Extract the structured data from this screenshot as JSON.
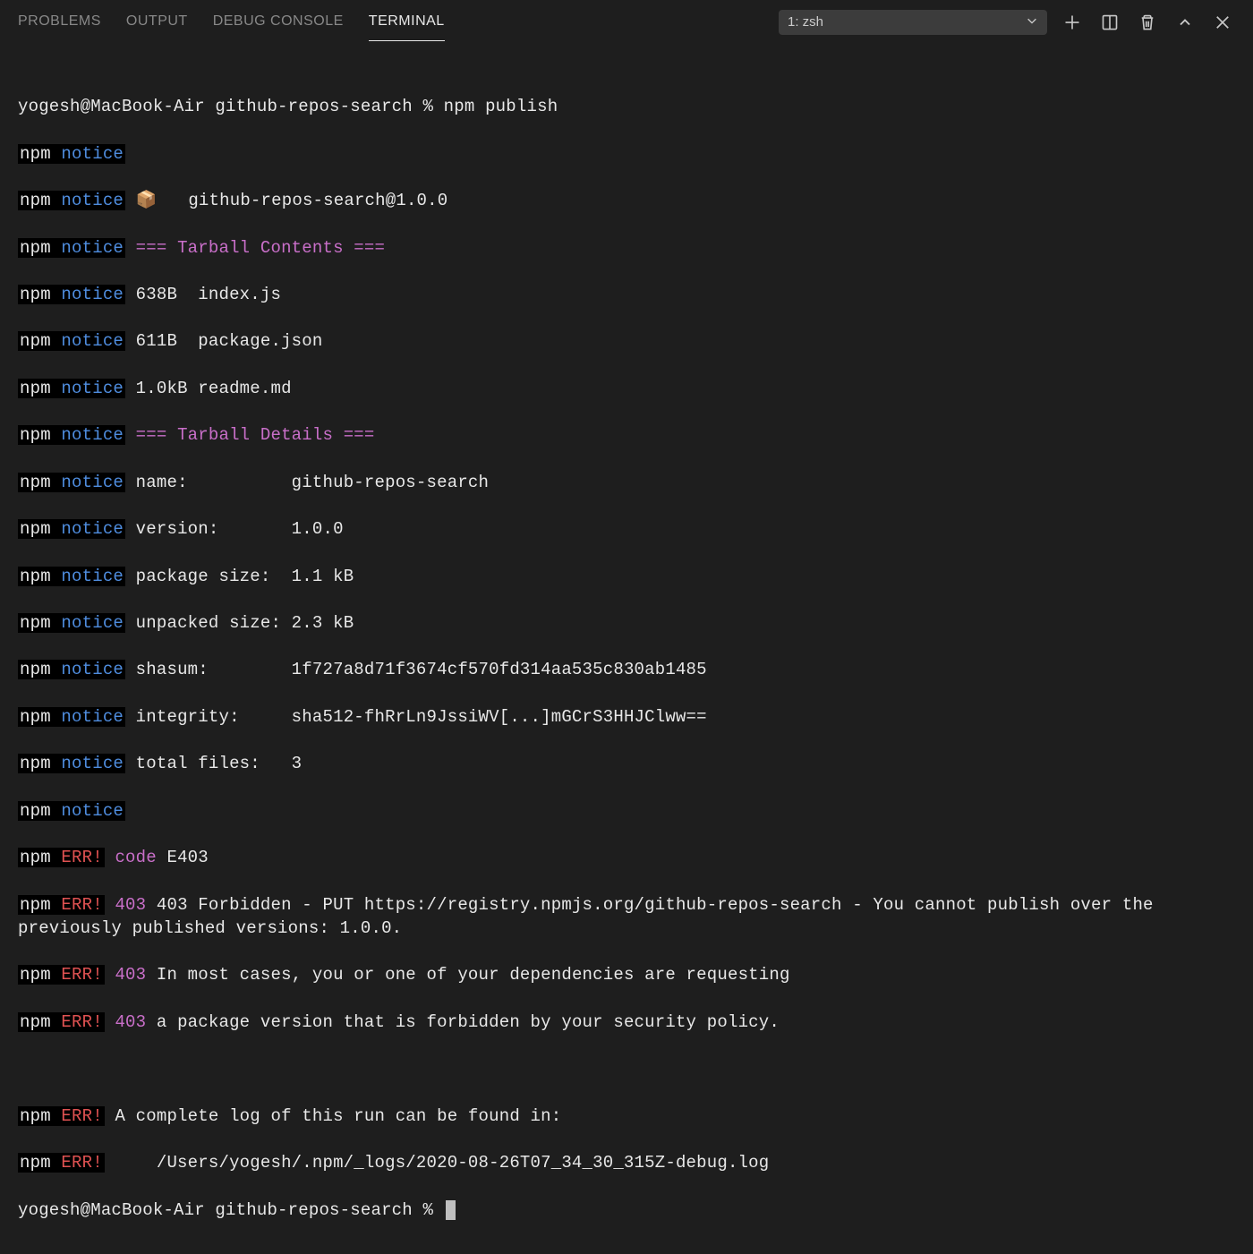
{
  "tabs": {
    "problems": "PROBLEMS",
    "output": "OUTPUT",
    "debug": "DEBUG CONSOLE",
    "terminal": "TERMINAL"
  },
  "dropdown": {
    "selected": "1: zsh"
  },
  "terminal": {
    "prompt1": "yogesh@MacBook-Air github-repos-search % npm publish",
    "npm": "npm",
    "notice": "notice",
    "err": "ERR!",
    "pkg_emoji": "📦",
    "pkg_line": "   github-repos-search@1.0.0",
    "tarball_contents": "=== Tarball Contents ===",
    "file1": "638B  index.js",
    "file2": "611B  package.json",
    "file3": "1.0kB readme.md",
    "tarball_details": "=== Tarball Details ===",
    "d_name": "name:          github-repos-search",
    "d_version": "version:       1.0.0",
    "d_pkgsize": "package size:  1.1 kB",
    "d_unpacked": "unpacked size: 2.3 kB",
    "d_shasum": "shasum:        1f727a8d71f3674cf570fd314aa535c830ab1485",
    "d_integrity": "integrity:     sha512-fhRrLn9JssiWV[...]mGCrS3HHJClww==",
    "d_total": "total files:   3",
    "err_code_label": "code",
    "err_code": " E403",
    "err_403": "403",
    "err_line1": " 403 Forbidden - PUT https://registry.npmjs.org/github-repos-search - You cannot publish over the previously published versions: 1.0.0.",
    "err_line2": " In most cases, you or one of your dependencies are requesting",
    "err_line3": " a package version that is forbidden by your security policy.",
    "err_log1": " A complete log of this run can be found in:",
    "err_log2": "     /Users/yogesh/.npm/_logs/2020-08-26T07_34_30_315Z-debug.log",
    "prompt2": "yogesh@MacBook-Air github-repos-search % "
  }
}
